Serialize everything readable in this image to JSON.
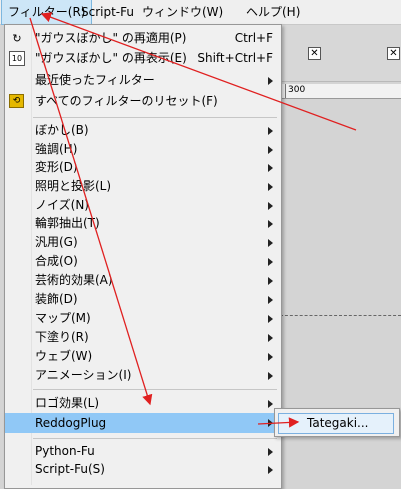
{
  "menubar": {
    "items": [
      {
        "label": "フィルター(R)",
        "active": true
      },
      {
        "label": "Script-Fu"
      },
      {
        "label": "ウィンドウ(W)"
      },
      {
        "label": "ヘルプ(H)"
      }
    ]
  },
  "filters_menu": {
    "top_items": [
      {
        "label": "\"ガウスぼかし\" の再適用(P)",
        "shortcut": "Ctrl+F",
        "icon": "repeat-filter-icon"
      },
      {
        "label": "\"ガウスぼかし\" の再表示(E)",
        "shortcut": "Shift+Ctrl+F",
        "icon": "reshow-filter-icon"
      },
      {
        "label": "最近使ったフィルター",
        "submenu": true
      },
      {
        "label": "すべてのフィルターのリセット(F)",
        "icon": "reset-filters-icon"
      }
    ],
    "category_items": [
      {
        "label": "ぼかし(B)"
      },
      {
        "label": "強調(H)"
      },
      {
        "label": "変形(D)"
      },
      {
        "label": "照明と投影(L)"
      },
      {
        "label": "ノイズ(N)"
      },
      {
        "label": "輪郭抽出(T)"
      },
      {
        "label": "汎用(G)"
      },
      {
        "label": "合成(O)"
      },
      {
        "label": "芸術的効果(A)"
      },
      {
        "label": "装飾(D)"
      },
      {
        "label": "マップ(M)"
      },
      {
        "label": "下塗り(R)"
      },
      {
        "label": "ウェブ(W)"
      },
      {
        "label": "アニメーション(I)"
      }
    ],
    "logo_item": {
      "label": "ロゴ効果(L)"
    },
    "reddog_item": {
      "label": "ReddogPlug"
    },
    "script_items": [
      {
        "label": "Python-Fu"
      },
      {
        "label": "Script-Fu(S)"
      }
    ]
  },
  "submenu": {
    "item_label": "Tategaki..."
  },
  "ruler": {
    "mark": "300"
  },
  "colors": {
    "highlight": "#90c8f6",
    "annotation_arrow": "#e02020"
  }
}
